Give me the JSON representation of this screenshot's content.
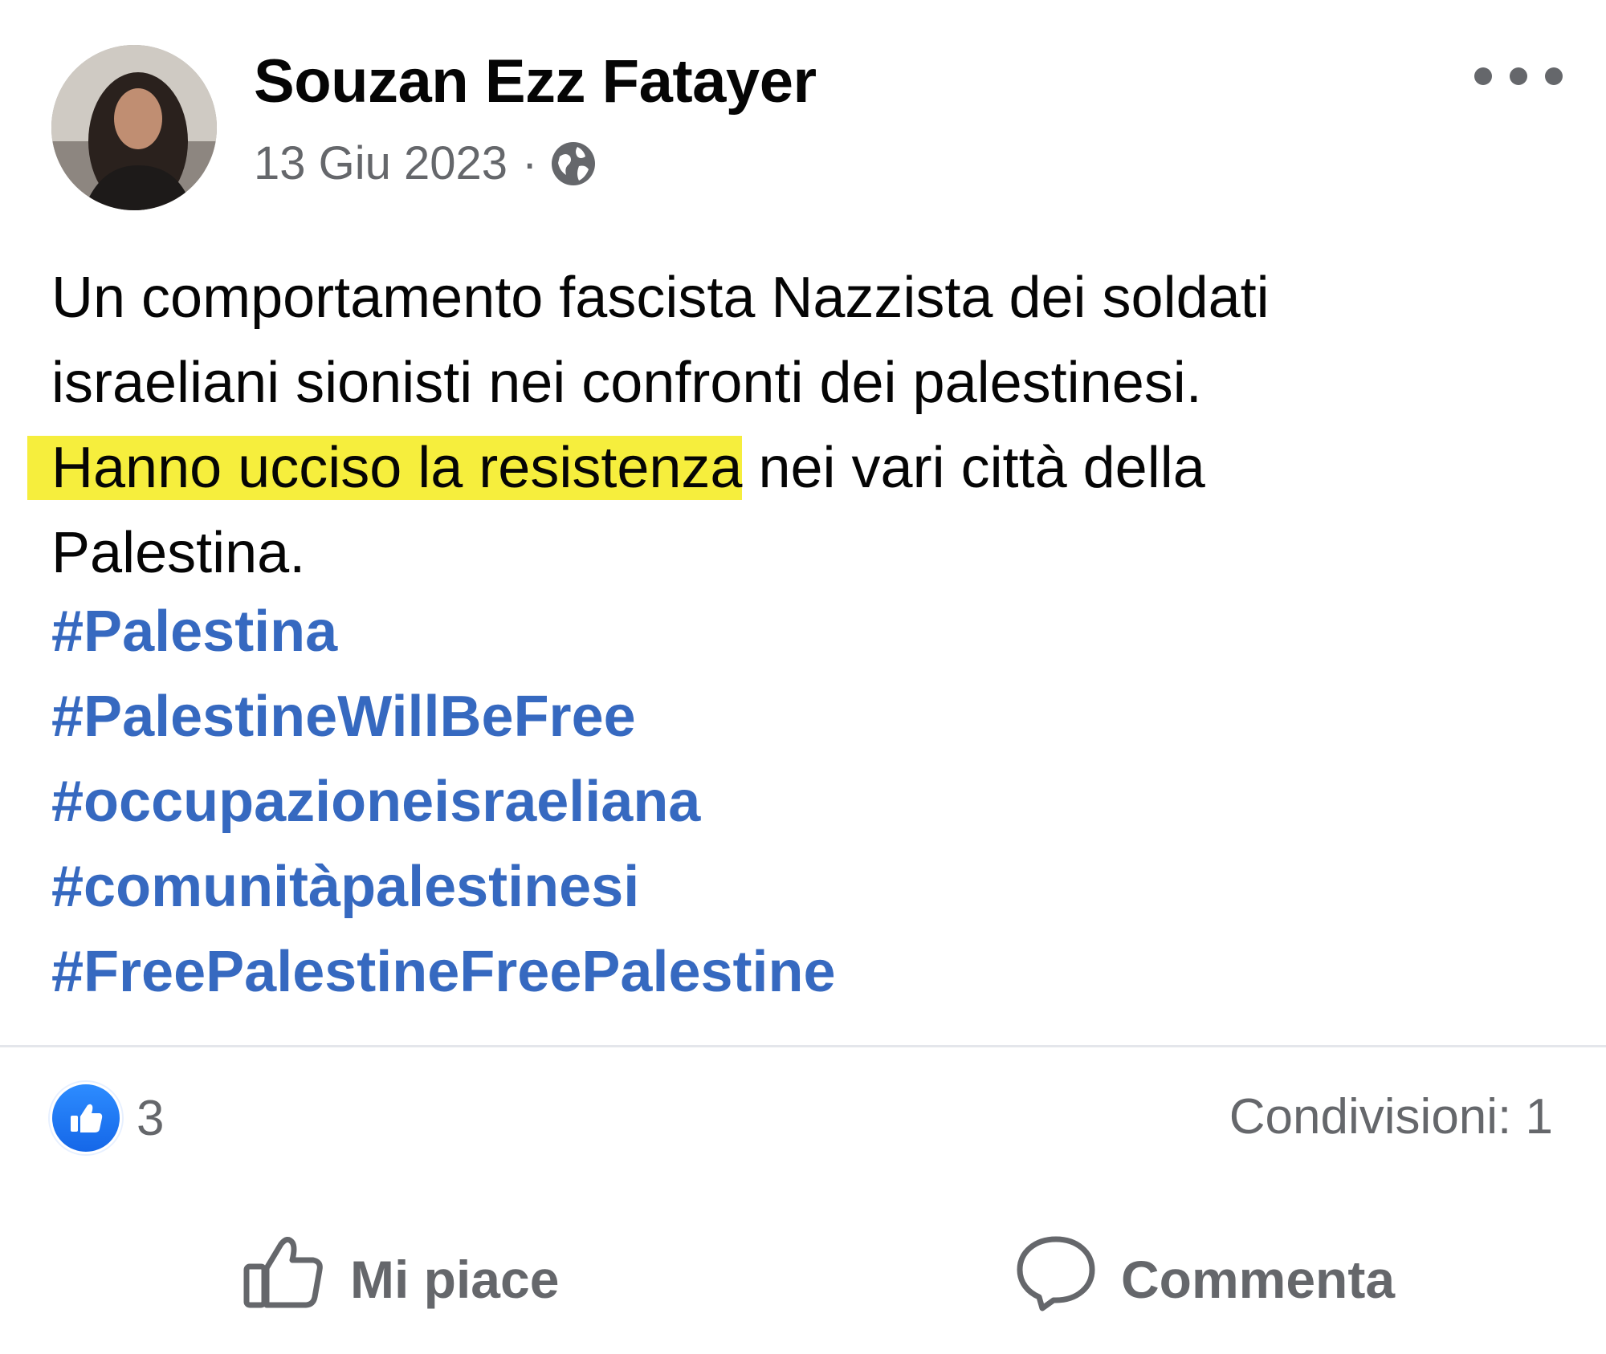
{
  "post": {
    "author": "Souzan Ezz Fatayer",
    "date": "13 Giu 2023",
    "separator": "·",
    "privacy_icon": "globe-icon",
    "more_icon": "more-options-icon",
    "text_lines": [
      "Un comportamento fascista Nazzista dei soldati",
      "israeliani sionisti nei confronti dei palestinesi."
    ],
    "highlighted_text": "Hanno ucciso la resistenza",
    "text_after_highlight": " nei vari città della",
    "last_line": "Palestina.",
    "hashtags": [
      "#Palestina",
      "#PalestineWillBeFree",
      "#occupazioneisraeliana",
      "#comunitàpalestinesi",
      "#FreePalestineFreePalestine"
    ]
  },
  "stats": {
    "reaction_icon": "like-reaction-icon",
    "reactions_count": "3",
    "shares": "Condivisioni: 1"
  },
  "actions": {
    "like_label": "Mi piace",
    "comment_label": "Commenta"
  },
  "colors": {
    "hashtag": "#3669c0",
    "highlight": "#f6ee3d",
    "secondary_text": "#65676b",
    "like_blue": "#1877f2"
  }
}
